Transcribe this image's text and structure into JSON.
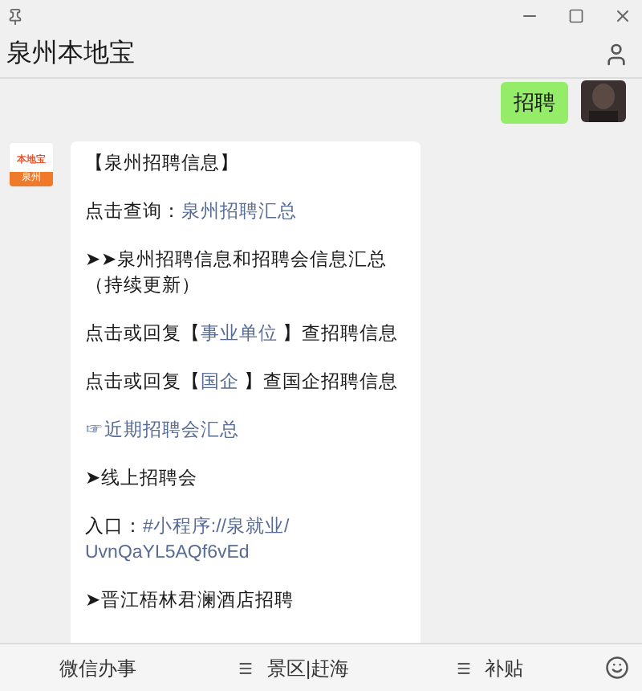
{
  "window": {
    "title": "泉州本地宝"
  },
  "messages": [
    {
      "kind": "sent",
      "text": "招聘"
    },
    {
      "kind": "received",
      "logo": {
        "top": "本地宝",
        "bottom": "泉州"
      },
      "paragraphs": [
        [
          {
            "text": "【泉州招聘信息】",
            "link": false
          }
        ],
        [
          {
            "text": "点击查询：",
            "link": false
          },
          {
            "text": "泉州招聘汇总",
            "link": true
          }
        ],
        [
          {
            "text": "➤➤泉州招聘信息和招聘会信息汇总（持续更新）",
            "link": false
          }
        ],
        [
          {
            "text": "点击或回复【",
            "link": false
          },
          {
            "text": "事业单位",
            "link": true
          },
          {
            "text": " 】查招聘信息",
            "link": false
          }
        ],
        [
          {
            "text": "点击或回复【",
            "link": false
          },
          {
            "text": "国企",
            "link": true
          },
          {
            "text": " 】查国企招聘信息",
            "link": false
          }
        ],
        [
          {
            "text": "☞近期招聘会汇总",
            "link": true
          }
        ],
        [
          {
            "text": "➤线上招聘会",
            "link": false
          }
        ],
        [
          {
            "text": "入口：",
            "link": false
          },
          {
            "text": "#小程序://泉就业/",
            "link": true
          },
          {
            "text": "UvnQaYL5AQf6vEd",
            "link": true
          }
        ],
        [
          {
            "text": "➤晋江梧林君澜酒店招聘",
            "link": false
          }
        ]
      ]
    }
  ],
  "menu": [
    {
      "label": "微信办事",
      "submenu": false
    },
    {
      "label": "景区|赶海",
      "submenu": true
    },
    {
      "label": "补贴",
      "submenu": true
    }
  ]
}
